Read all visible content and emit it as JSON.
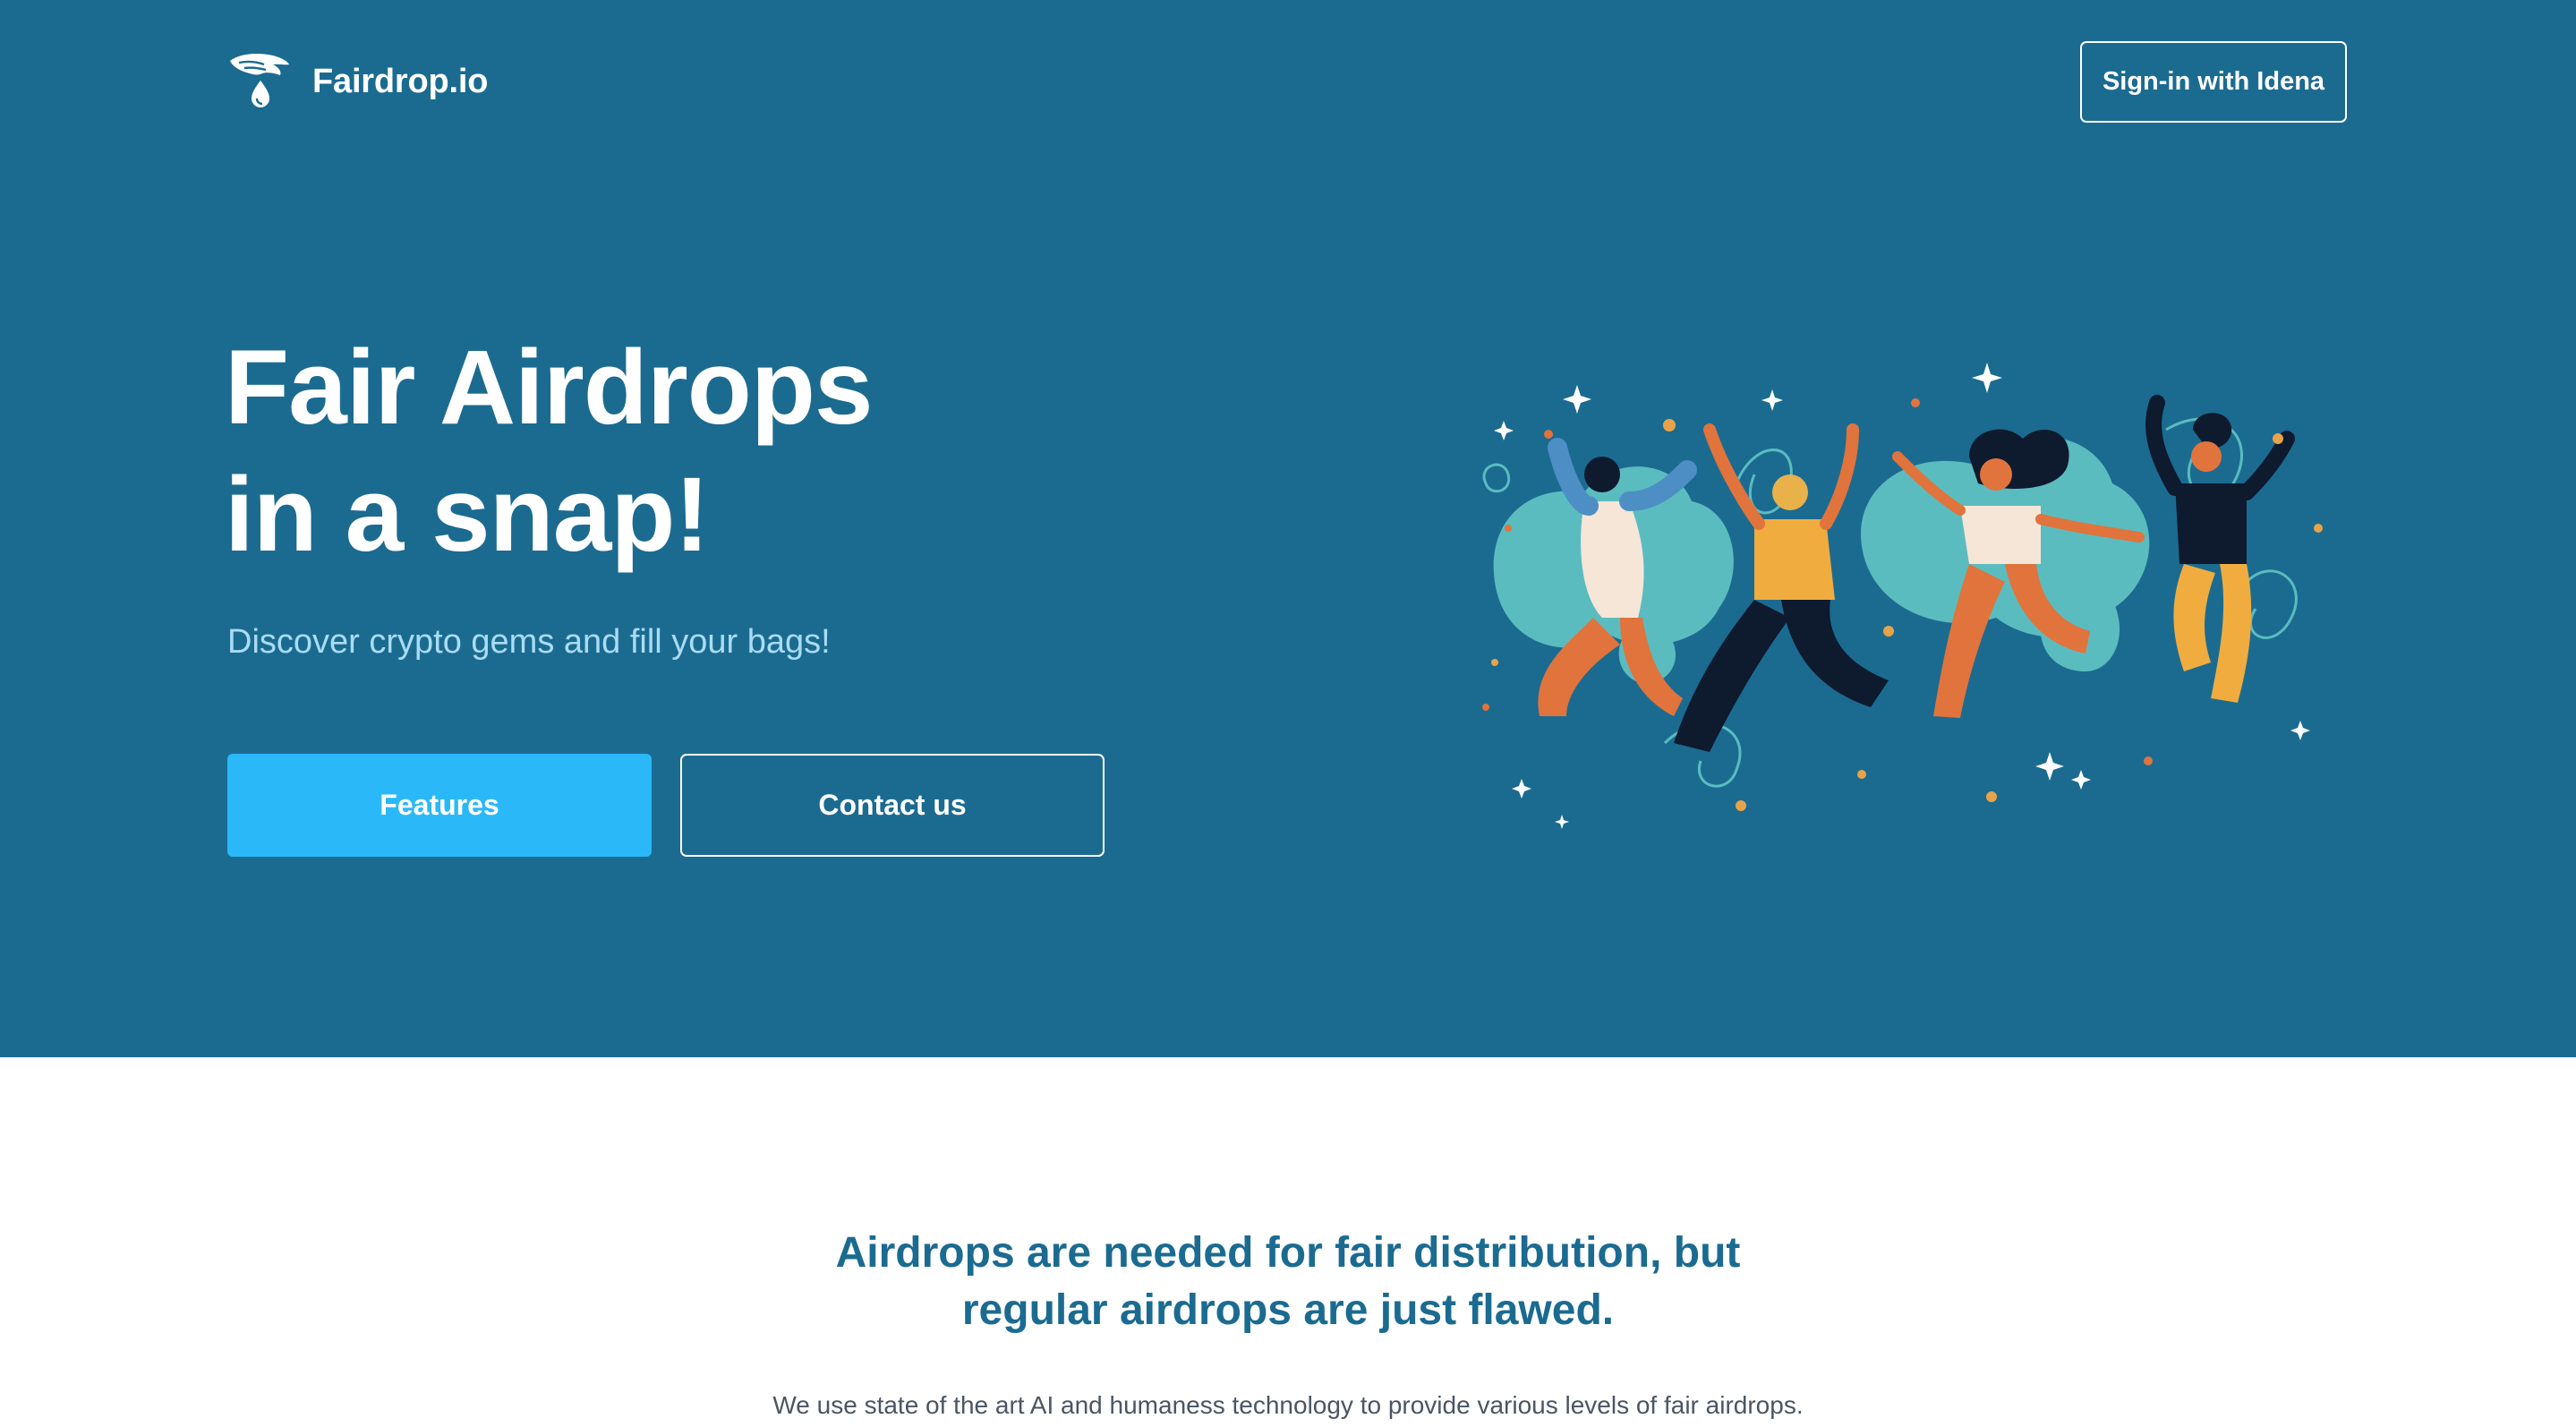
{
  "header": {
    "brand": "Fairdrop.io",
    "logo_icon": "hand-drop-icon",
    "signin_label": "Sign-in with Idena"
  },
  "hero": {
    "title_line1": "Fair Airdrops",
    "title_line2": "in a snap!",
    "subtitle": "Discover crypto gems and fill your bags!",
    "primary_button": "Features",
    "secondary_button": "Contact us",
    "illustration": "people-celebrating-illustration"
  },
  "section": {
    "title_line1": "Airdrops are needed for fair distribution, but",
    "title_line2": "regular airdrops are just flawed.",
    "text": "We use state of the art AI and humaness technology to provide various levels of fair airdrops."
  },
  "colors": {
    "hero_bg": "#1b6b91",
    "primary": "#2bb8f8",
    "subtitle": "#a9dcf5",
    "section_title": "#1b6b91",
    "body_text": "#4b5563"
  }
}
